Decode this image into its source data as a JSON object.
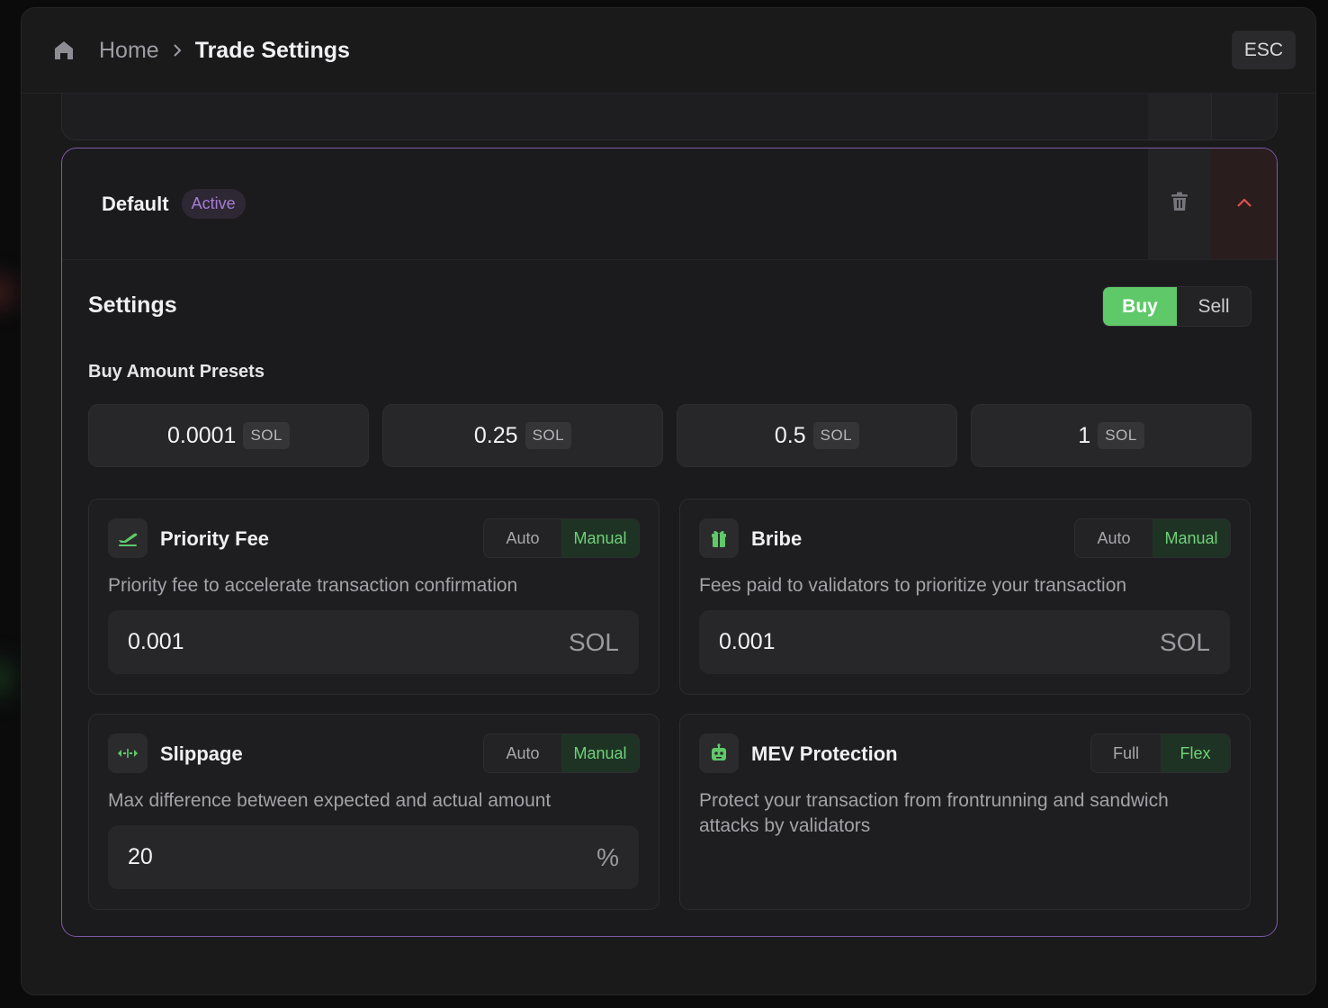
{
  "header": {
    "home_label": "Home",
    "current_label": "Trade Settings",
    "esc_label": "ESC"
  },
  "preset": {
    "name": "Default",
    "status_badge": "Active"
  },
  "settings": {
    "title": "Settings",
    "side_toggle": {
      "options": [
        "Buy",
        "Sell"
      ],
      "selected": "Buy"
    },
    "presets_label": "Buy Amount Presets",
    "amount_presets": [
      {
        "value": "0.0001",
        "unit": "SOL"
      },
      {
        "value": "0.25",
        "unit": "SOL"
      },
      {
        "value": "0.5",
        "unit": "SOL"
      },
      {
        "value": "1",
        "unit": "SOL"
      }
    ],
    "priority_fee": {
      "title": "Priority Fee",
      "icon": "plane-takeoff-icon",
      "modes": [
        "Auto",
        "Manual"
      ],
      "selected_mode": "Manual",
      "description": "Priority fee to accelerate transaction confirmation",
      "value": "0.001",
      "unit": "SOL"
    },
    "bribe": {
      "title": "Bribe",
      "icon": "gift-icon",
      "modes": [
        "Auto",
        "Manual"
      ],
      "selected_mode": "Manual",
      "description": "Fees paid to validators to prioritize your transaction",
      "value": "0.001",
      "unit": "SOL"
    },
    "slippage": {
      "title": "Slippage",
      "icon": "arrows-horizontal-icon",
      "modes": [
        "Auto",
        "Manual"
      ],
      "selected_mode": "Manual",
      "description": "Max difference between expected and actual amount",
      "value": "20",
      "unit": "%"
    },
    "mev_protection": {
      "title": "MEV Protection",
      "icon": "robot-icon",
      "modes": [
        "Full",
        "Flex"
      ],
      "selected_mode": "Flex",
      "description": "Protect your transaction from frontrunning and sandwich attacks by validators"
    }
  },
  "colors": {
    "accent_green": "#5fc96a",
    "accent_purple": "#a77bd6",
    "card_border": "#7e5aa6",
    "background": "#1a1a1b"
  }
}
